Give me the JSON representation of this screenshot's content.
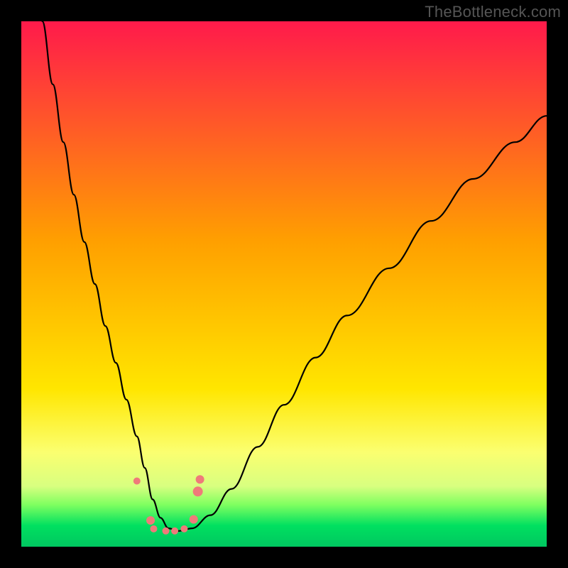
{
  "watermark": "TheBottleneck.com",
  "chart_data": {
    "type": "line",
    "title": "",
    "xlabel": "",
    "ylabel": "",
    "xlim": [
      0,
      100
    ],
    "ylim": [
      0,
      100
    ],
    "background_gradient": {
      "stops": [
        {
          "offset": 0.0,
          "color": "#ff1a4b"
        },
        {
          "offset": 0.42,
          "color": "#ffa000"
        },
        {
          "offset": 0.7,
          "color": "#ffe600"
        },
        {
          "offset": 0.82,
          "color": "#fbff70"
        },
        {
          "offset": 0.885,
          "color": "#d8ff80"
        },
        {
          "offset": 0.92,
          "color": "#7fff60"
        },
        {
          "offset": 0.96,
          "color": "#00e060"
        },
        {
          "offset": 1.0,
          "color": "#00c760"
        }
      ]
    },
    "series": [
      {
        "name": "bottleneck-curve",
        "x": [
          4,
          6,
          8,
          10,
          12,
          14,
          16,
          18,
          20,
          22,
          23.5,
          25,
          26.5,
          28,
          30,
          32.5,
          36,
          40,
          45,
          50,
          56,
          62,
          70,
          78,
          86,
          94,
          100
        ],
        "values": [
          100,
          88,
          77,
          67,
          58,
          50,
          42,
          35,
          28,
          21,
          15,
          9,
          5.5,
          3.5,
          3,
          3.5,
          6,
          11,
          19,
          27,
          36,
          44,
          53,
          62,
          70,
          77,
          82
        ]
      }
    ],
    "markers": {
      "name": "highlight-dots",
      "color": "#ef7a7a",
      "points": [
        {
          "x": 22.0,
          "y": 12.5,
          "r": 5
        },
        {
          "x": 24.6,
          "y": 5.0,
          "r": 6
        },
        {
          "x": 25.2,
          "y": 3.4,
          "r": 5
        },
        {
          "x": 27.5,
          "y": 3.0,
          "r": 5
        },
        {
          "x": 29.2,
          "y": 3.0,
          "r": 5
        },
        {
          "x": 31.0,
          "y": 3.4,
          "r": 5
        },
        {
          "x": 32.8,
          "y": 5.2,
          "r": 6
        },
        {
          "x": 33.6,
          "y": 10.5,
          "r": 7
        },
        {
          "x": 34.0,
          "y": 12.8,
          "r": 6
        }
      ]
    }
  }
}
